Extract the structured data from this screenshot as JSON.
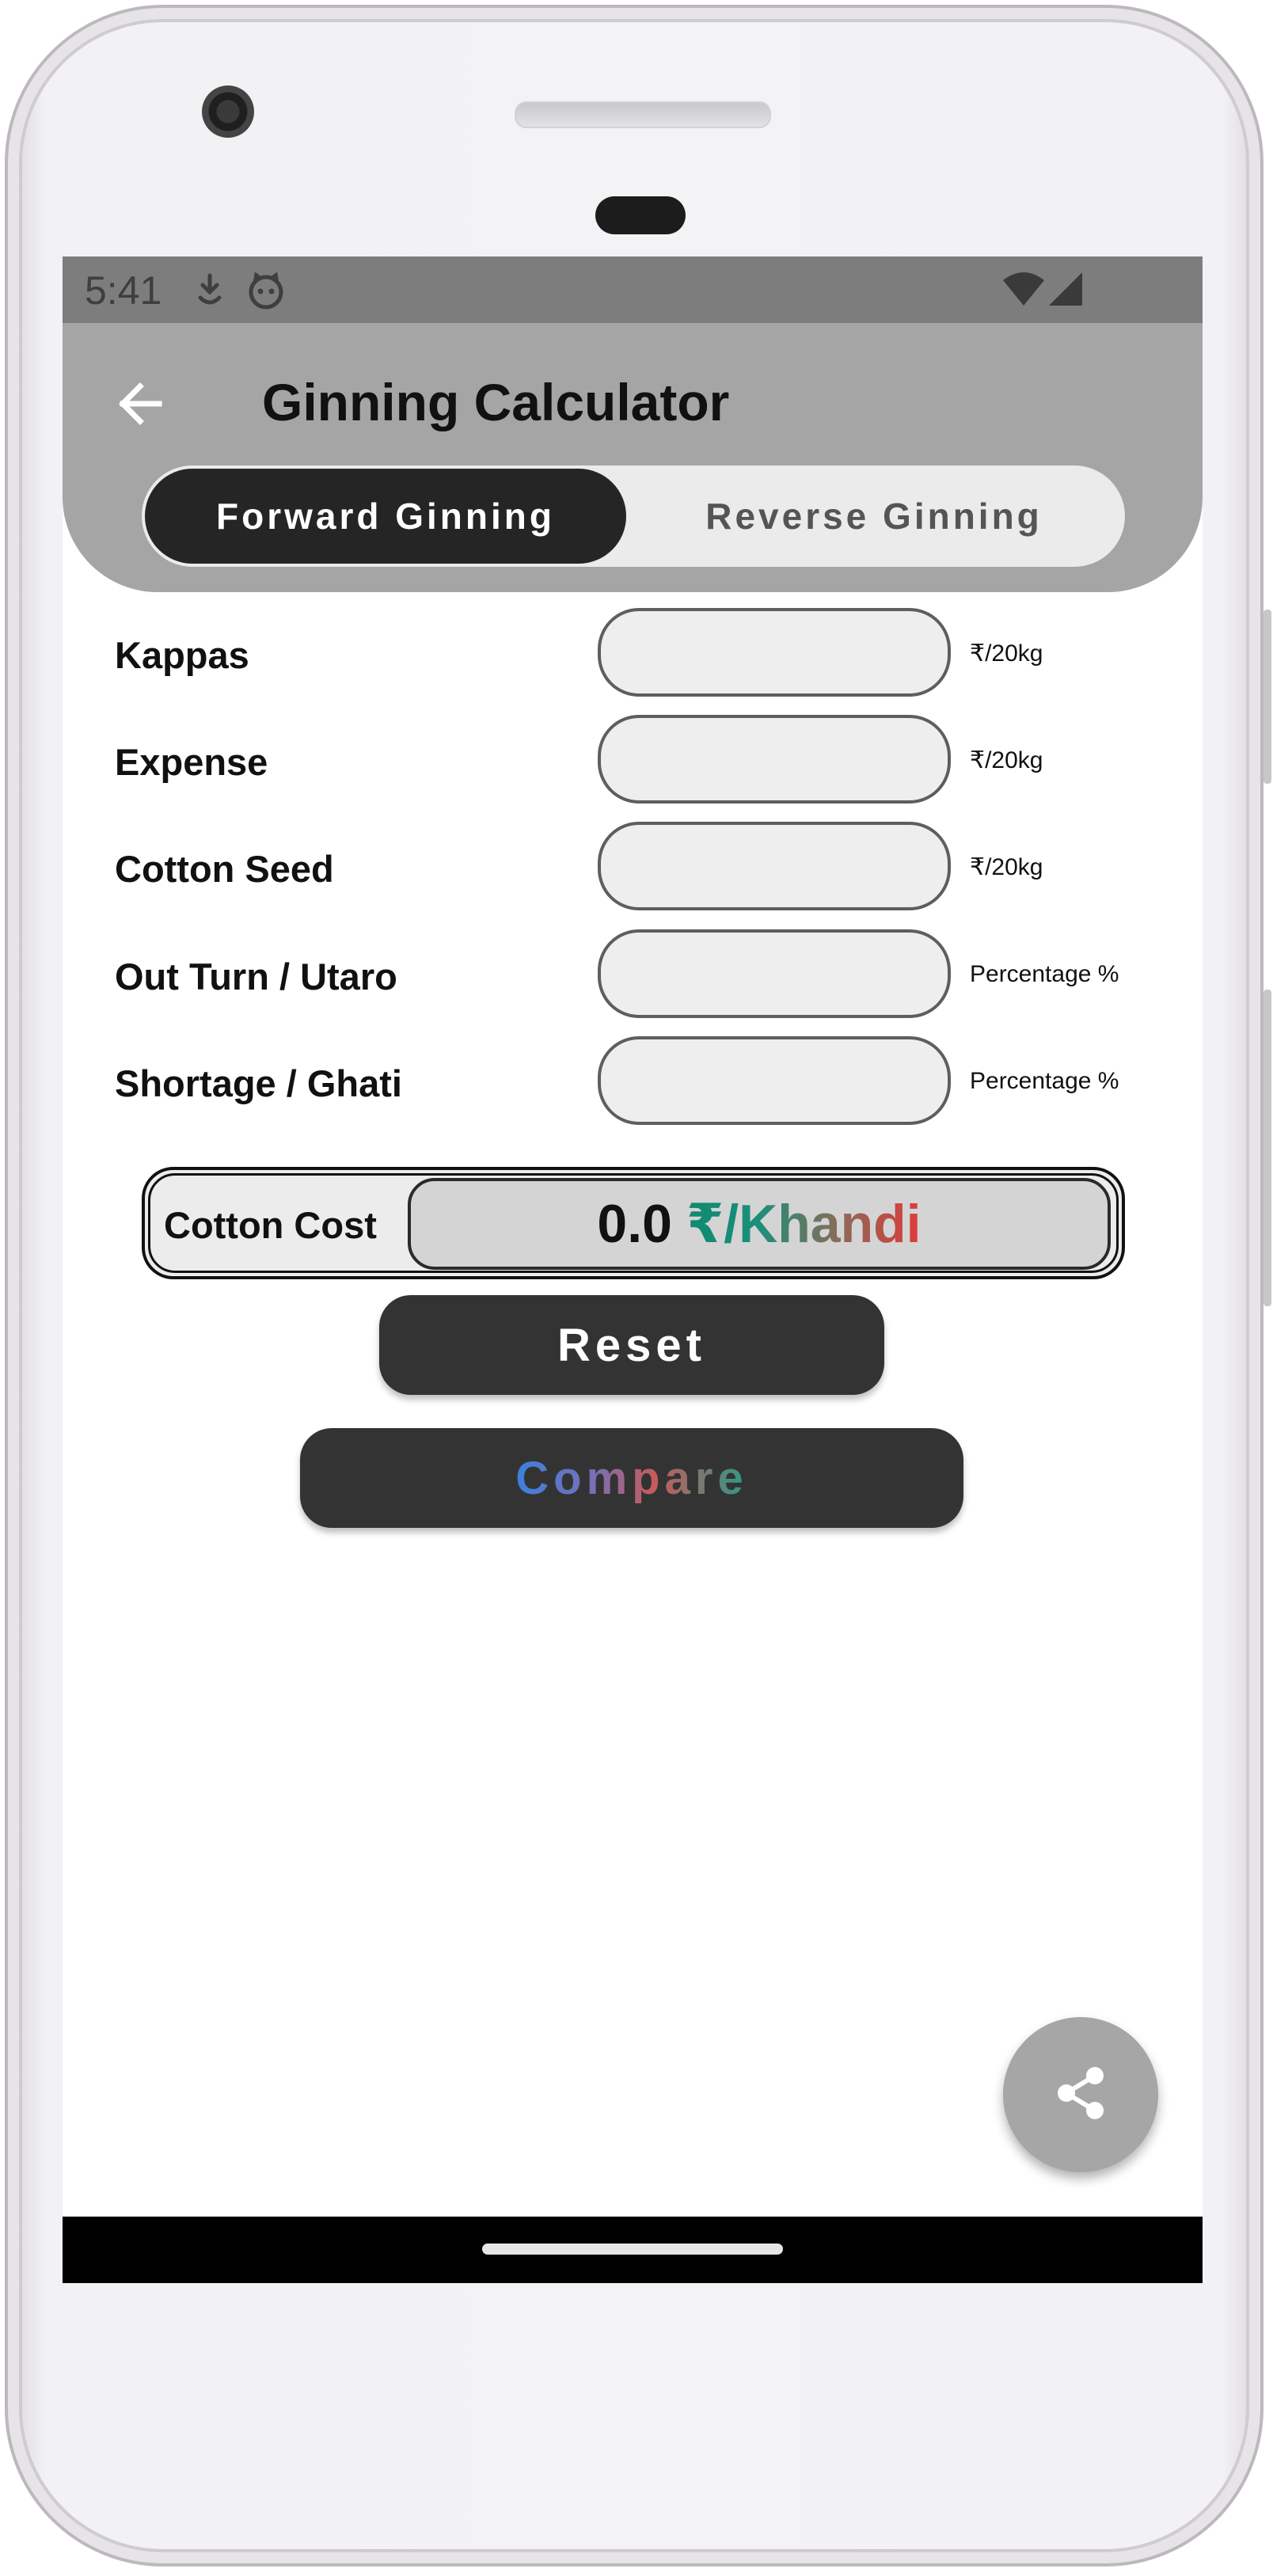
{
  "status_bar": {
    "time": "5:41"
  },
  "app_bar": {
    "title": "Ginning Calculator",
    "tabs": [
      {
        "label": "Forward Ginning",
        "selected": true
      },
      {
        "label": "Reverse Ginning",
        "selected": false
      }
    ]
  },
  "form": {
    "rows": [
      {
        "label": "Kappas",
        "value": "",
        "unit": "₹/20kg"
      },
      {
        "label": "Expense",
        "value": "",
        "unit": "₹/20kg"
      },
      {
        "label": "Cotton Seed",
        "value": "",
        "unit": "₹/20kg"
      },
      {
        "label": "Out Turn / Utaro",
        "value": "",
        "unit": "Percentage %"
      },
      {
        "label": "Shortage / Ghati",
        "value": "",
        "unit": "Percentage %"
      }
    ]
  },
  "result": {
    "label": "Cotton Cost",
    "value": "0.0",
    "unit": "₹/Khandi"
  },
  "buttons": {
    "reset": "Reset",
    "compare": "Compare"
  },
  "icons": {
    "back": "arrow-left-icon",
    "share": "share-icon",
    "status": [
      "download-icon",
      "cat-face-icon",
      "wifi-icon",
      "cell-signal-icon"
    ]
  },
  "colors": {
    "app_bar": "#a5a5a5",
    "status_bar": "#7d7d7d",
    "selected_tab": "#252525",
    "button": "#333333",
    "fab": "#a6a6a6"
  }
}
